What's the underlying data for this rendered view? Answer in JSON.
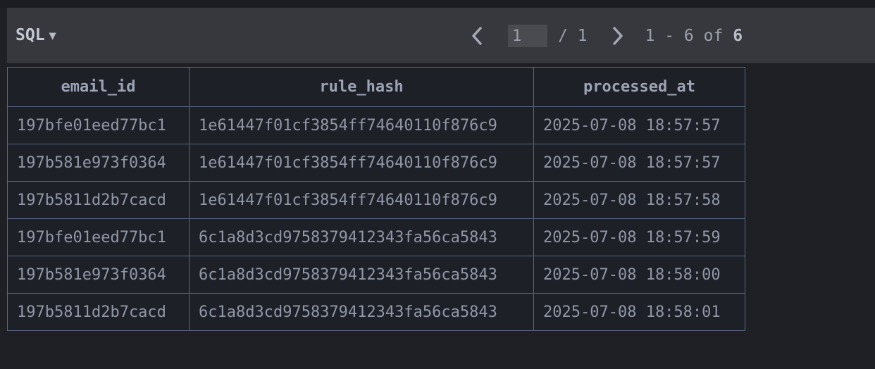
{
  "toolbar": {
    "language": "SQL",
    "page_current": "1",
    "page_total": "/ 1",
    "range_text": "1 - 6 of",
    "range_total": "6"
  },
  "table": {
    "columns": [
      "email_id",
      "rule_hash",
      "processed_at"
    ],
    "rows": [
      [
        "197bfe01eed77bc1",
        "1e61447f01cf3854ff74640110f876c9",
        "2025-07-08 18:57:57"
      ],
      [
        "197b581e973f0364",
        "1e61447f01cf3854ff74640110f876c9",
        "2025-07-08 18:57:57"
      ],
      [
        "197b5811d2b7cacd",
        "1e61447f01cf3854ff74640110f876c9",
        "2025-07-08 18:57:58"
      ],
      [
        "197bfe01eed77bc1",
        "6c1a8d3cd9758379412343fa56ca5843",
        "2025-07-08 18:57:59"
      ],
      [
        "197b581e973f0364",
        "6c1a8d3cd9758379412343fa56ca5843",
        "2025-07-08 18:58:00"
      ],
      [
        "197b5811d2b7cacd",
        "6c1a8d3cd9758379412343fa56ca5843",
        "2025-07-08 18:58:01"
      ]
    ]
  }
}
